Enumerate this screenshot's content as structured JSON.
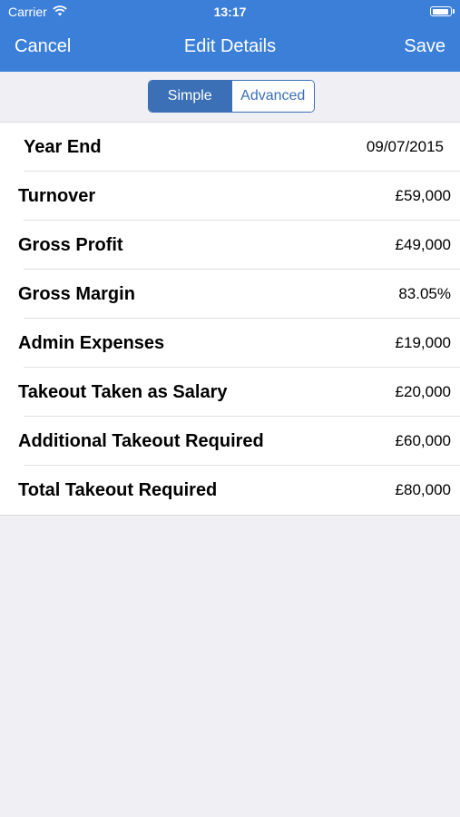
{
  "status": {
    "carrier": "Carrier",
    "time": "13:17"
  },
  "nav": {
    "cancel": "Cancel",
    "title": "Edit Details",
    "save": "Save"
  },
  "segment": {
    "options": [
      "Simple",
      "Advanced"
    ],
    "selected": "Simple"
  },
  "rows": [
    {
      "label": "Year End",
      "value": "09/07/2015"
    },
    {
      "label": "Turnover",
      "value": "£59,000"
    },
    {
      "label": "Gross Profit",
      "value": "£49,000"
    },
    {
      "label": "Gross Margin",
      "value": "83.05%"
    },
    {
      "label": "Admin Expenses",
      "value": "£19,000"
    },
    {
      "label": "Takeout Taken as Salary",
      "value": "£20,000"
    },
    {
      "label": "Additional Takeout Required",
      "value": "£60,000"
    },
    {
      "label": "Total Takeout Required",
      "value": "£80,000"
    }
  ],
  "colors": {
    "accent": "#3b7fd9",
    "segment": "#3b6fb6",
    "background": "#efeff4"
  },
  "icons": [
    "wifi-icon",
    "battery-icon"
  ]
}
